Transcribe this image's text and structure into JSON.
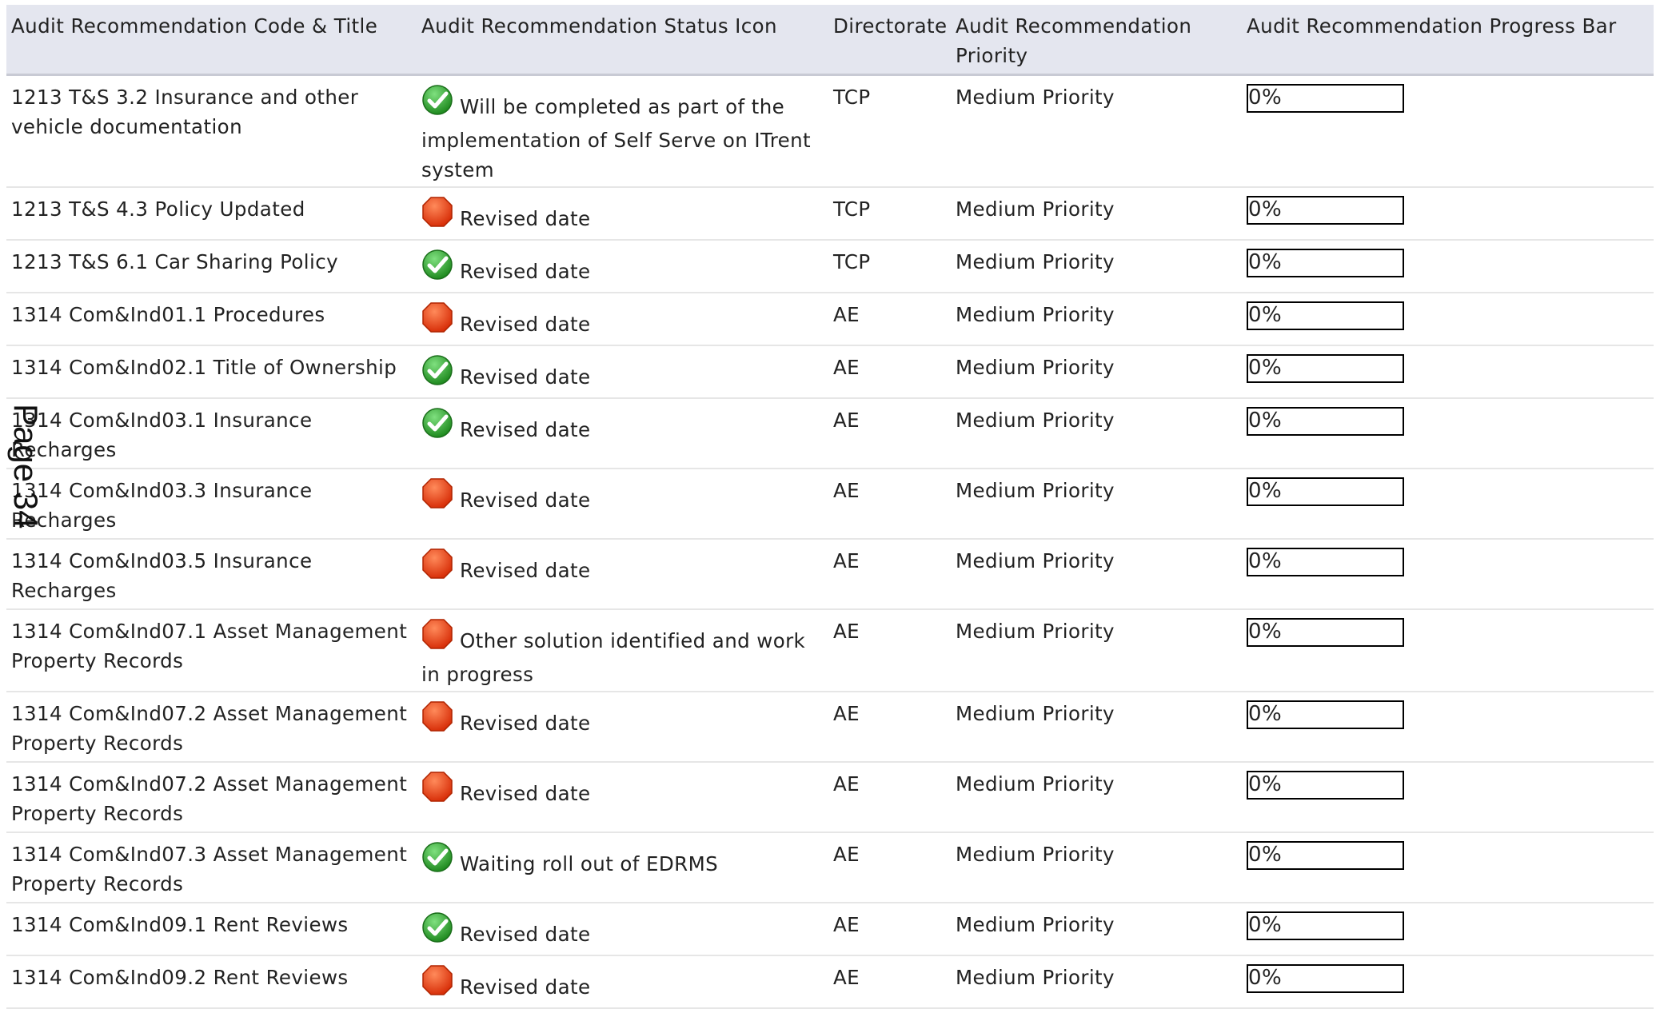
{
  "table": {
    "headers": [
      "Audit Recommendation Code & Title",
      "Audit Recommendation Status Icon",
      "Directorate",
      "Audit Recommendation Priority",
      "Audit Recommendation Progress Bar"
    ],
    "rows": [
      {
        "title": "1213 T&S 3.2 Insurance and other vehicle documentation",
        "status_icon": "green-check-icon",
        "status": "Will be completed as part of the implementation of Self Serve on ITrent system",
        "directorate": "TCP",
        "priority": "Medium Priority",
        "progress": "0%",
        "progress_value": 0
      },
      {
        "title": "1213 T&S 4.3 Policy Updated",
        "status_icon": "red-octagon-icon",
        "status": "Revised date",
        "directorate": "TCP",
        "priority": "Medium Priority",
        "progress": "0%",
        "progress_value": 0
      },
      {
        "title": "1213 T&S 6.1 Car Sharing Policy",
        "status_icon": "green-check-icon",
        "status": "Revised date",
        "directorate": "TCP",
        "priority": "Medium Priority",
        "progress": "0%",
        "progress_value": 0
      },
      {
        "title": "1314 Com&Ind01.1 Procedures",
        "status_icon": "red-octagon-icon",
        "status": "Revised date",
        "directorate": "AE",
        "priority": "Medium Priority",
        "progress": "0%",
        "progress_value": 0
      },
      {
        "title": "1314 Com&Ind02.1 Title of Ownership",
        "status_icon": "green-check-icon",
        "status": "Revised date",
        "directorate": "AE",
        "priority": "Medium Priority",
        "progress": "0%",
        "progress_value": 0
      },
      {
        "title": "1314 Com&Ind03.1 Insurance Recharges",
        "status_icon": "green-check-icon",
        "status": "Revised date",
        "directorate": "AE",
        "priority": "Medium Priority",
        "progress": "0%",
        "progress_value": 0
      },
      {
        "title": "1314 Com&Ind03.3 Insurance Recharges",
        "status_icon": "red-octagon-icon",
        "status": "Revised date",
        "directorate": "AE",
        "priority": "Medium Priority",
        "progress": "0%",
        "progress_value": 0
      },
      {
        "title": "1314 Com&Ind03.5 Insurance Recharges",
        "status_icon": "red-octagon-icon",
        "status": "Revised date",
        "directorate": "AE",
        "priority": "Medium Priority",
        "progress": "0%",
        "progress_value": 0
      },
      {
        "title": "1314 Com&Ind07.1 Asset Management Property Records",
        "status_icon": "red-octagon-icon",
        "status": "Other solution identified and work in progress",
        "directorate": "AE",
        "priority": "Medium Priority",
        "progress": "0%",
        "progress_value": 0
      },
      {
        "title": "1314 Com&Ind07.2 Asset Management Property Records",
        "status_icon": "red-octagon-icon",
        "status": "Revised date",
        "directorate": "AE",
        "priority": "Medium Priority",
        "progress": "0%",
        "progress_value": 0
      },
      {
        "title": "1314 Com&Ind07.2 Asset Management Property Records",
        "status_icon": "red-octagon-icon",
        "status": "Revised date",
        "directorate": "AE",
        "priority": "Medium Priority",
        "progress": "0%",
        "progress_value": 0
      },
      {
        "title": "1314 Com&Ind07.3 Asset Management Property Records",
        "status_icon": "green-check-icon",
        "status": "Waiting roll out of EDRMS",
        "directorate": "AE",
        "priority": "Medium Priority",
        "progress": "0%",
        "progress_value": 0
      },
      {
        "title": "1314 Com&Ind09.1 Rent Reviews",
        "status_icon": "green-check-icon",
        "status": "Revised date",
        "directorate": "AE",
        "priority": "Medium Priority",
        "progress": "0%",
        "progress_value": 0
      },
      {
        "title": "1314 Com&Ind09.2 Rent Reviews",
        "status_icon": "red-octagon-icon",
        "status": "Revised date",
        "directorate": "AE",
        "priority": "Medium Priority",
        "progress": "0%",
        "progress_value": 0
      }
    ]
  },
  "page_label": "Page 34",
  "colors": {
    "header_bg": "#e4e6ef",
    "check_green": "#2e9e2e",
    "stop_red": "#e8441c",
    "progress_fill": "#4caf50"
  }
}
